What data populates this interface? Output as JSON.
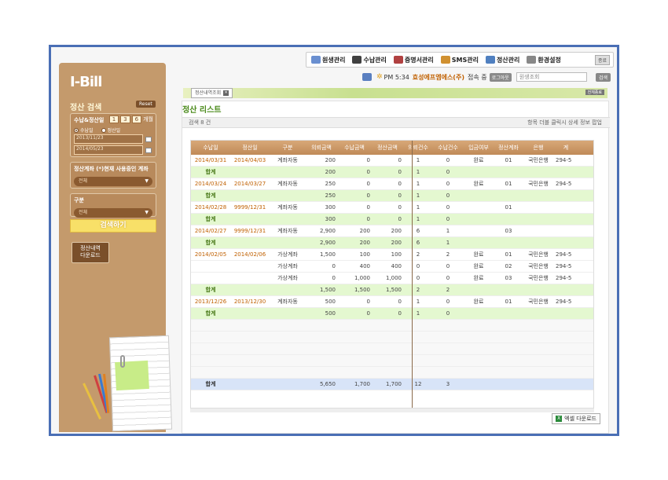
{
  "app": {
    "logo": "I-Bill"
  },
  "topmenu": {
    "items": [
      {
        "label": "원생관리",
        "color": "#6a8fd0"
      },
      {
        "label": "수납관리",
        "color": "#404040"
      },
      {
        "label": "증명서관리",
        "color": "#b04040"
      },
      {
        "label": "SMS관리",
        "color": "#d09030"
      },
      {
        "label": "정산관리",
        "color": "#5080c0"
      },
      {
        "label": "환경설정",
        "color": "#888888"
      }
    ],
    "logout": "종료"
  },
  "status": {
    "time": "PM 5:34",
    "company": "효성에프엠에스(주)",
    "connected": "접속 중",
    "logout_btn": "로그아웃",
    "search_placeholder": "원생조회",
    "search_btn": "검색"
  },
  "sidebar": {
    "title": "정산 검색",
    "reset": "Reset",
    "date_box": {
      "label": "수납&정산일",
      "periods": [
        "1",
        "3",
        "6"
      ],
      "period_unit": "개월",
      "radio_pay": "수납일",
      "radio_settle": "정산일",
      "from": "2013/11/23",
      "to": "2014/05/23"
    },
    "account_box": {
      "label": "정산계좌 (*)현재 사용중인 계좌",
      "value": "전체"
    },
    "type_box": {
      "label": "구분",
      "value": "전체"
    },
    "search_btn": "검색하기",
    "download_btn_l1": "정산내역",
    "download_btn_l2": "다운로드"
  },
  "tab": {
    "label": "정산내역조회",
    "close_all": "전체종료"
  },
  "list": {
    "title": "정산 리스트",
    "count": "검색 8 건",
    "hint": "항목 더블 클릭시 상세 정보 팝업",
    "headers": [
      "수납일",
      "정산일",
      "구분",
      "의뢰금액",
      "수납금액",
      "정산금액",
      "의뢰건수",
      "수납건수",
      "입금여부",
      "정산계좌",
      "은행",
      "계"
    ],
    "rows": [
      {
        "kind": "data",
        "cells": [
          "2014/03/31",
          "2014/04/03",
          "계좌자동",
          "200",
          "0",
          "0",
          "1",
          "0",
          "완료",
          "01",
          "국민은행",
          "294-5"
        ]
      },
      {
        "kind": "sub",
        "cells": [
          "합계",
          "",
          "",
          "200",
          "0",
          "0",
          "1",
          "0",
          "",
          "",
          "",
          ""
        ]
      },
      {
        "kind": "data",
        "cells": [
          "2014/03/24",
          "2014/03/27",
          "계좌자동",
          "250",
          "0",
          "0",
          "1",
          "0",
          "완료",
          "01",
          "국민은행",
          "294-5"
        ]
      },
      {
        "kind": "sub",
        "cells": [
          "합계",
          "",
          "",
          "250",
          "0",
          "0",
          "1",
          "0",
          "",
          "",
          "",
          ""
        ]
      },
      {
        "kind": "data",
        "cells": [
          "2014/02/28",
          "9999/12/31",
          "계좌자동",
          "300",
          "0",
          "0",
          "1",
          "0",
          "",
          "01",
          "",
          ""
        ]
      },
      {
        "kind": "sub",
        "cells": [
          "합계",
          "",
          "",
          "300",
          "0",
          "0",
          "1",
          "0",
          "",
          "",
          "",
          ""
        ]
      },
      {
        "kind": "data",
        "cells": [
          "2014/02/27",
          "9999/12/31",
          "계좌자동",
          "2,900",
          "200",
          "200",
          "6",
          "1",
          "",
          "03",
          "",
          ""
        ]
      },
      {
        "kind": "sub",
        "cells": [
          "합계",
          "",
          "",
          "2,900",
          "200",
          "200",
          "6",
          "1",
          "",
          "",
          "",
          ""
        ]
      },
      {
        "kind": "data",
        "cells": [
          "2014/02/05",
          "2014/02/06",
          "가상계좌",
          "1,500",
          "100",
          "100",
          "2",
          "2",
          "완료",
          "01",
          "국민은행",
          "294-5"
        ]
      },
      {
        "kind": "data",
        "cells": [
          "",
          "",
          "가상계좌",
          "0",
          "400",
          "400",
          "0",
          "0",
          "완료",
          "02",
          "국민은행",
          "294-5"
        ]
      },
      {
        "kind": "data",
        "cells": [
          "",
          "",
          "가상계좌",
          "0",
          "1,000",
          "1,000",
          "0",
          "0",
          "완료",
          "03",
          "국민은행",
          "294-5"
        ]
      },
      {
        "kind": "sub",
        "cells": [
          "합계",
          "",
          "",
          "1,500",
          "1,500",
          "1,500",
          "2",
          "2",
          "",
          "",
          "",
          ""
        ]
      },
      {
        "kind": "data",
        "cells": [
          "2013/12/26",
          "2013/12/30",
          "계좌자동",
          "500",
          "0",
          "0",
          "1",
          "0",
          "완료",
          "01",
          "국민은행",
          "294-5"
        ]
      },
      {
        "kind": "sub",
        "cells": [
          "합계",
          "",
          "",
          "500",
          "0",
          "0",
          "1",
          "0",
          "",
          "",
          "",
          ""
        ]
      }
    ],
    "total": [
      "합계",
      "",
      "",
      "5,650",
      "1,700",
      "1,700",
      "12",
      "3",
      "",
      "",
      "",
      ""
    ],
    "excel_btn": "엑셀 다운로드"
  }
}
